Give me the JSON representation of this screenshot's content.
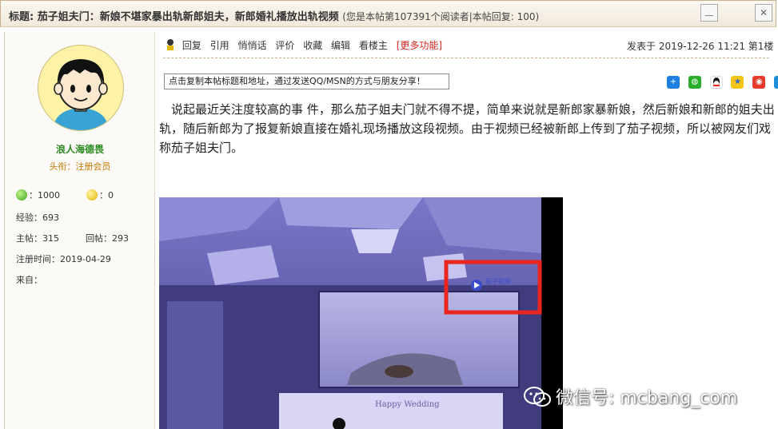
{
  "thread": {
    "title_label": "标题: 茄子姐夫门：新娘不堪家暴出轨新郎姐夫，新郎婚礼播放出轨视频",
    "meta": "(您是本帖第107391个阅读者|本帖回复: 100)"
  },
  "user": {
    "name": "浪人海德畏",
    "rank": "头衔：注册会员",
    "coins_green": "：1000",
    "coins_yellow": "：0",
    "experience": "经验：693",
    "posts": "主帖：315",
    "replies": "回帖：293",
    "register_time": "注册时间：2019-04-29",
    "from": "来自："
  },
  "toolbar": {
    "reply": "回复",
    "quote": "引用",
    "whisper": "悄悄话",
    "rate": "评价",
    "favorite": "收藏",
    "edit": "编辑",
    "view_author": "看楼主",
    "more": "[更多功能]"
  },
  "post_info": "发表于 2019-12-26 11:21 第1楼",
  "copy_box_text": "点击复制本帖标题和地址，通过发送QQ/MSN的方式与朋友分享！",
  "share_icons": [
    "plus-icon",
    "wechat-icon",
    "qq-icon",
    "qzone-icon",
    "weibo-icon",
    "pengyou-icon"
  ],
  "article": {
    "paragraph": "　说起最近关注度较高的事 件，那么茄子姐夫门就不得不提，简单来说就是新郎家暴新娘，然后新娘和新郎的姐夫出轨，随后新郎为了报复新娘直接在婚礼现场播放这段视频。由于视频已经被新郎上传到了茄子视频，所以被网友们戏称茄子姐夫门。"
  },
  "video": {
    "screen_logo": "茄子视频",
    "highlight_color": "#e8261d",
    "banner_text": "Happy Wedding"
  },
  "watermark": "微信号: mcbang_com",
  "colors": {
    "username": "#2c8a1f",
    "rank": "#c77a00",
    "more_link": "#d8261f"
  }
}
